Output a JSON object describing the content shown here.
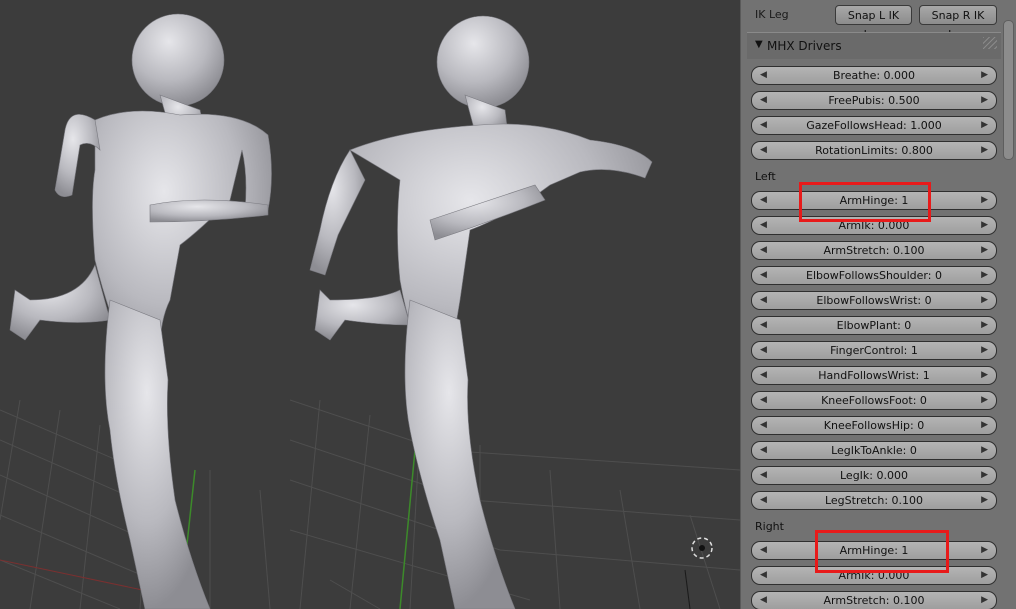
{
  "ik_leg": {
    "label": "IK Leg",
    "snap_left": "Snap L IK Leg",
    "snap_right": "Snap R IK Leg"
  },
  "drivers_panel": {
    "title": "MHX Drivers",
    "global": [
      "Breathe: 0.000",
      "FreePubis: 0.500",
      "GazeFollowsHead: 1.000",
      "RotationLimits: 0.800"
    ],
    "left_label": "Left",
    "left": [
      "ArmHinge: 1",
      "ArmIk: 0.000",
      "ArmStretch: 0.100",
      "ElbowFollowsShoulder: 0",
      "ElbowFollowsWrist: 0",
      "ElbowPlant: 0",
      "FingerControl: 1",
      "HandFollowsWrist: 1",
      "KneeFollowsFoot: 0",
      "KneeFollowsHip: 0",
      "LegIkToAnkle: 0",
      "LegIk: 0.000",
      "LegStretch: 0.100"
    ],
    "right_label": "Right",
    "right": [
      "ArmHinge: 1",
      "ArmIk: 0.000",
      "ArmStretch: 0.100"
    ]
  },
  "colors": {
    "viewport_bg": "#3c3c3c",
    "panel_bg": "#727272",
    "highlight": "#e81a1a"
  }
}
